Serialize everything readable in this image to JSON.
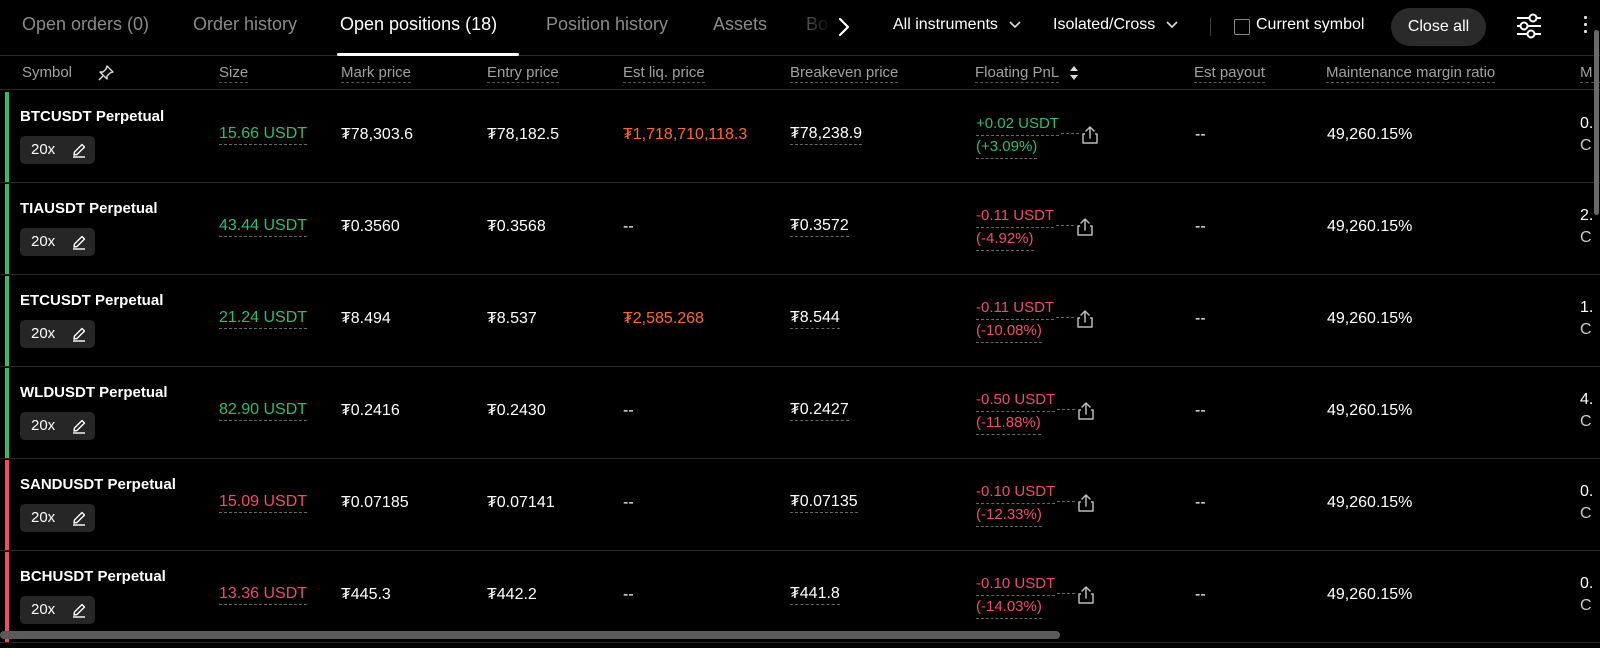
{
  "tabs": [
    {
      "label": "Open orders (0)"
    },
    {
      "label": "Order history"
    },
    {
      "label": "Open positions (18)"
    },
    {
      "label": "Position history"
    },
    {
      "label": "Assets"
    },
    {
      "label": "Bo"
    }
  ],
  "filters": {
    "instruments": "All instruments",
    "margin_mode": "Isolated/Cross",
    "current_symbol_label": "Current symbol",
    "current_symbol_checked": false,
    "close_all": "Close all"
  },
  "columns": {
    "symbol": "Symbol",
    "size": "Size",
    "mark_price": "Mark price",
    "entry_price": "Entry price",
    "est_liq_price": "Est liq. price",
    "breakeven_price": "Breakeven price",
    "floating_pnl": "Floating PnL",
    "est_payout": "Est payout",
    "maintenance_margin_ratio": "Maintenance margin ratio",
    "next_cut": "M"
  },
  "rows": [
    {
      "symbol": "BTCUSDT Perpetual",
      "leverage": "20x",
      "side_color": "#2ebd6b",
      "size": "15.66 USDT",
      "mark_price": "₮78,303.6",
      "entry_price": "₮78,182.5",
      "est_liq_price": "₮1,718,710,118.3",
      "breakeven_price": "₮78,238.9",
      "pnl": "+0.02 USDT",
      "pnl_pct": "(+3.09%)",
      "est_payout": "--",
      "mmr": "49,260.15%",
      "cut1": "0.",
      "cut2": "C"
    },
    {
      "symbol": "TIAUSDT Perpetual",
      "leverage": "20x",
      "side_color": "#2ebd6b",
      "size": "43.44 USDT",
      "mark_price": "₮0.3560",
      "entry_price": "₮0.3568",
      "est_liq_price": "--",
      "breakeven_price": "₮0.3572",
      "pnl": "-0.11 USDT",
      "pnl_pct": "(-4.92%)",
      "est_payout": "--",
      "mmr": "49,260.15%",
      "cut1": "2.",
      "cut2": "C"
    },
    {
      "symbol": "ETCUSDT Perpetual",
      "leverage": "20x",
      "side_color": "#2ebd6b",
      "size": "21.24 USDT",
      "mark_price": "₮8.494",
      "entry_price": "₮8.537",
      "est_liq_price": "₮2,585.268",
      "breakeven_price": "₮8.544",
      "pnl": "-0.11 USDT",
      "pnl_pct": "(-10.08%)",
      "est_payout": "--",
      "mmr": "49,260.15%",
      "cut1": "1.",
      "cut2": "C"
    },
    {
      "symbol": "WLDUSDT Perpetual",
      "leverage": "20x",
      "side_color": "#2ebd6b",
      "size": "82.90 USDT",
      "mark_price": "₮0.2416",
      "entry_price": "₮0.2430",
      "est_liq_price": "--",
      "breakeven_price": "₮0.2427",
      "pnl": "-0.50 USDT",
      "pnl_pct": "(-11.88%)",
      "est_payout": "--",
      "mmr": "49,260.15%",
      "cut1": "4.",
      "cut2": "C"
    },
    {
      "symbol": "SANDUSDT Perpetual",
      "leverage": "20x",
      "side_color": "#f04b67",
      "size": "15.09 USDT",
      "mark_price": "₮0.07185",
      "entry_price": "₮0.07141",
      "est_liq_price": "--",
      "breakeven_price": "₮0.07135",
      "pnl": "-0.10 USDT",
      "pnl_pct": "(-12.33%)",
      "est_payout": "--",
      "mmr": "49,260.15%",
      "cut1": "0.",
      "cut2": "C"
    },
    {
      "symbol": "BCHUSDT Perpetual",
      "leverage": "20x",
      "side_color": "#f04b67",
      "size": "13.36 USDT",
      "mark_price": "₮445.3",
      "entry_price": "₮442.2",
      "est_liq_price": "--",
      "breakeven_price": "₮441.8",
      "pnl": "-0.10 USDT",
      "pnl_pct": "(-14.03%)",
      "est_payout": "--",
      "mmr": "49,260.15%",
      "cut1": "0.",
      "cut2": "C"
    }
  ],
  "colors": {
    "long": "#2ebd6b",
    "short": "#f04b67",
    "liq": "#ff6a2c"
  }
}
